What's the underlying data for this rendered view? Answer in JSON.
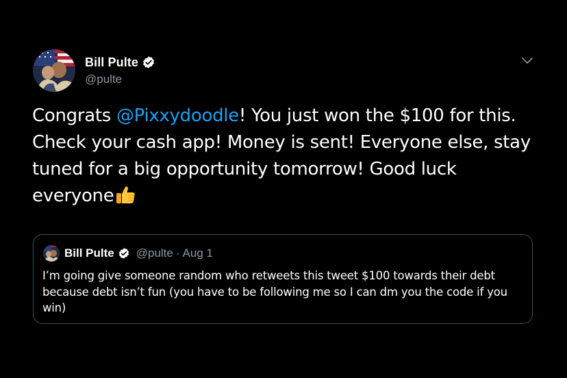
{
  "author": {
    "display_name": "Bill Pulte",
    "handle": "@pulte",
    "verified_icon": "verified-badge-icon",
    "avatar_icon": "profile-avatar"
  },
  "tweet": {
    "text_before": "Congrats ",
    "mention": "@Pixxydoodle",
    "text_after": "! You just won the $100 for this. Check your cash app! Money is sent! Everyone else, stay tuned for a big opportunity tomorrow!  Good luck everyone",
    "emoji_icon": "thumbs-up-icon"
  },
  "menu": {
    "icon": "chevron-down-icon"
  },
  "quoted_tweet": {
    "display_name": "Bill Pulte",
    "handle": "@pulte",
    "separator": "·",
    "date": "Aug 1",
    "text": "I’m going give someone random who retweets this tweet $100 towards their debt because debt isn’t fun (you have to be following me so I can dm you the code if you win)"
  },
  "colors": {
    "background": "#000000",
    "text": "#ffffff",
    "secondary_text": "#8899a6",
    "link": "#1da1f2",
    "border": "#3d4f5c",
    "verified": "#ffffff"
  }
}
